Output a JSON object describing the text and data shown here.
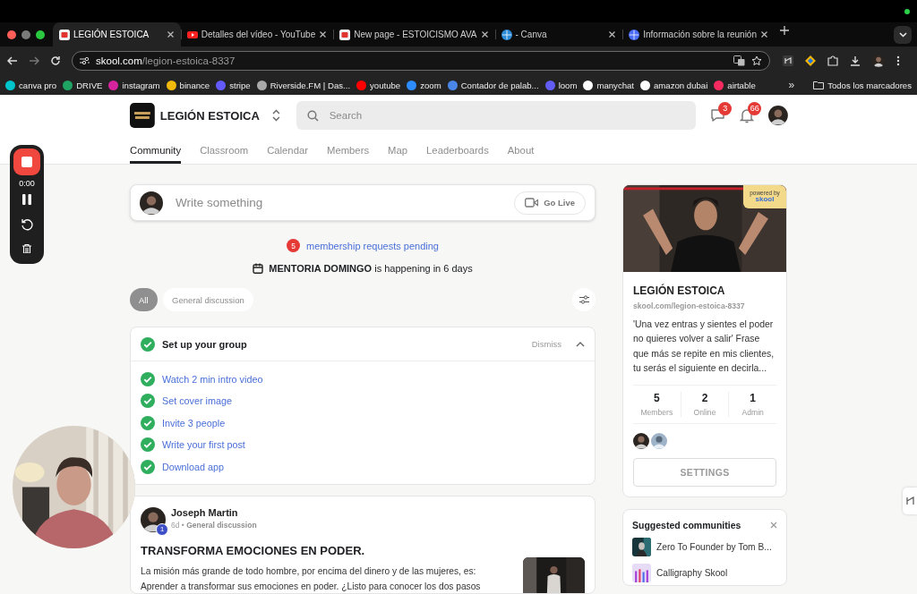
{
  "browser": {
    "tabs": [
      {
        "title": "LEGIÓN ESTOICA",
        "selected": true
      },
      {
        "title": "Detalles del vídeo - YouTube",
        "selected": false
      },
      {
        "title": "New page - ESTOICISMO AVA",
        "selected": false
      },
      {
        "title": "- Canva",
        "selected": false
      },
      {
        "title": "Información sobre la reunión",
        "selected": false
      }
    ],
    "url_host": "skool.com",
    "url_path": "/legion-estoica-8337",
    "bookmarks": [
      "canva pro",
      "DRIVE",
      "instagram",
      "binance",
      "stripe",
      "Riverside.FM | Das...",
      "youtube",
      "zoom",
      "Contador de palab...",
      "loom",
      "manychat",
      "amazon dubai",
      "airtable"
    ],
    "more_bookmarks": "»",
    "all_bookmarks": "Todos los marcadores"
  },
  "header": {
    "community": "LEGIÓN ESTOICA",
    "search_placeholder": "Search",
    "chat_badge": "3",
    "notification_badge": "66"
  },
  "nav": [
    {
      "label": "Community",
      "selected": true
    },
    {
      "label": "Classroom",
      "selected": false
    },
    {
      "label": "Calendar",
      "selected": false
    },
    {
      "label": "Members",
      "selected": false
    },
    {
      "label": "Map",
      "selected": false
    },
    {
      "label": "Leaderboards",
      "selected": false
    },
    {
      "label": "About",
      "selected": false
    }
  ],
  "composer": {
    "placeholder": "Write something",
    "go_live": "Go Live"
  },
  "pending": {
    "count": "5",
    "text": "membership requests pending"
  },
  "event": "**MENTORIA DOMINGO** is happening in 6 days",
  "filters": [
    {
      "label": "All",
      "selected": true
    },
    {
      "label": "General discussion",
      "selected": false
    }
  ],
  "setup": {
    "title": "Set up your group",
    "dismiss": "Dismiss",
    "expanded": true,
    "items": [
      {
        "label": "Watch 2 min intro video",
        "done": true
      },
      {
        "label": "Set cover image",
        "done": true
      },
      {
        "label": "Invite 3 people",
        "done": true
      },
      {
        "label": "Write your first post",
        "done": true
      },
      {
        "label": "Download app",
        "done": true
      }
    ]
  },
  "post": {
    "author": "Joseph Martin",
    "level": "1",
    "meta": "6d • **General discussion**",
    "title": "TRANSFORMA EMOCIONES EN PODER.",
    "body": "La misión más grande de todo hombre, por encima del dinero y de las mujeres, es: Aprender a transformar sus emociones en poder. ¿Listo para conocer los dos pasos"
  },
  "sidebar": {
    "ribbon": [
      "powered by",
      "skool"
    ],
    "name": "LEGIÓN ESTOICA",
    "url": "skool.com/legion-estoica-8337",
    "description": "'Una vez entras y sientes el poder no quieres volver a salir' Frase que más se repite en mis clientes, tu serás el siguiente en decirla...",
    "stats": [
      {
        "value": "5",
        "label": "Members"
      },
      {
        "value": "2",
        "label": "Online"
      },
      {
        "value": "1",
        "label": "Admin"
      }
    ],
    "button": "SETTINGS"
  },
  "suggested": {
    "title": "Suggested communities",
    "items": [
      "Zero To Founder by Tom B...",
      "Calligraphy Skool"
    ]
  },
  "recorder": {
    "time": "0:00"
  }
}
